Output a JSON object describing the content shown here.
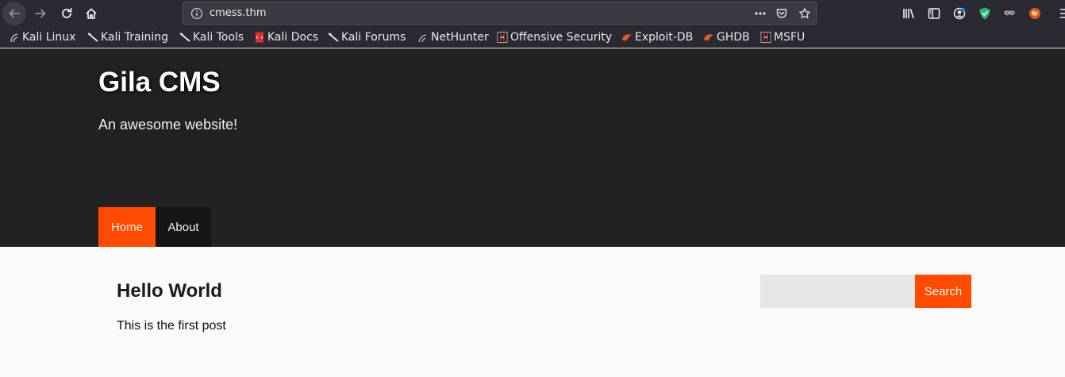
{
  "browser": {
    "url": "cmess.thm",
    "bookmarks": [
      {
        "label": "Kali Linux",
        "icon": "kali-dragon-icon"
      },
      {
        "label": "Kali Training",
        "icon": "kali-dragon-icon"
      },
      {
        "label": "Kali Tools",
        "icon": "kali-dragon-icon"
      },
      {
        "label": "Kali Docs",
        "icon": "kali-docs-icon"
      },
      {
        "label": "Kali Forums",
        "icon": "kali-dragon-icon"
      },
      {
        "label": "NetHunter",
        "icon": "nethunter-icon"
      },
      {
        "label": "Offensive Security",
        "icon": "offsec-icon"
      },
      {
        "label": "Exploit-DB",
        "icon": "exploitdb-icon"
      },
      {
        "label": "GHDB",
        "icon": "exploitdb-icon"
      },
      {
        "label": "MSFU",
        "icon": "offsec-icon"
      }
    ],
    "colors": {
      "chrome": "#2b2a33",
      "urlbar": "#3b3a41"
    }
  },
  "site": {
    "title": "Gila CMS",
    "tagline": "An awesome website!",
    "menu": [
      {
        "label": "Home",
        "active": true
      },
      {
        "label": "About",
        "active": false
      }
    ],
    "colors": {
      "header": "#222222",
      "accent": "#ff4a00",
      "menu_inactive": "#151515"
    }
  },
  "post": {
    "title": "Hello World",
    "body": "This is the first post"
  },
  "search": {
    "value": "",
    "placeholder": "",
    "button_label": "Search"
  }
}
